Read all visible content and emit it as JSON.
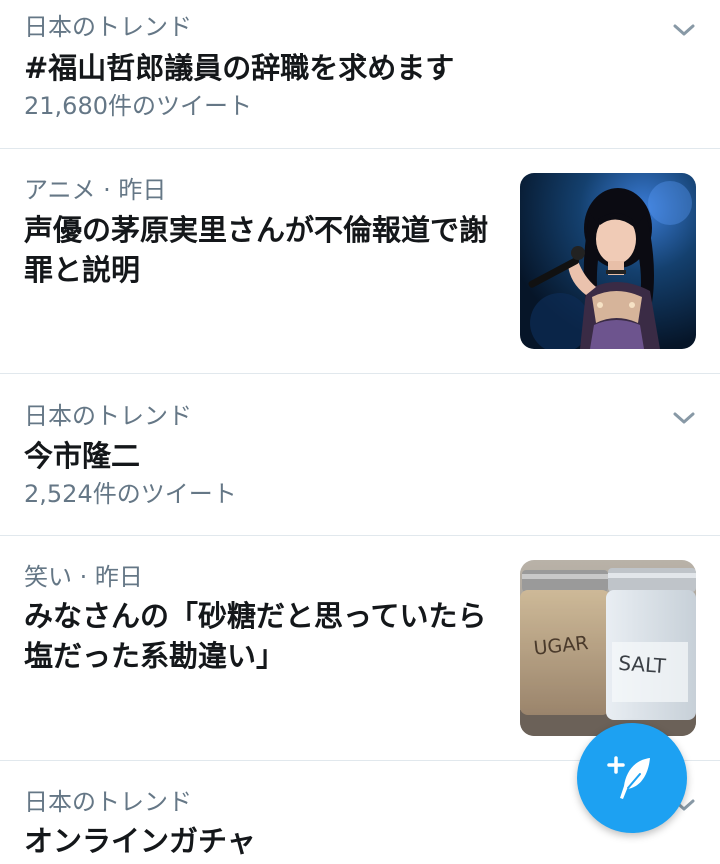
{
  "trends": [
    {
      "context": "日本のトレンド",
      "title": "#福山哲郎議員の辞職を求めます",
      "meta": "21,680件のツイート"
    },
    {
      "context": "アニメ · 昨日",
      "title": "声優の茅原実里さんが不倫報道で謝罪と説明",
      "image": "concert-singer-photo"
    },
    {
      "context": "日本のトレンド",
      "title": "今市隆二",
      "meta": "2,524件のツイート"
    },
    {
      "context": "笑い · 昨日",
      "title": "みなさんの「砂糖だと思っていたら塩だった系勘違い」",
      "image": "sugar-salt-jars-photo",
      "image_labels": {
        "left_jar": "UGAR",
        "right_jar": "SALT"
      }
    },
    {
      "context": "日本のトレンド",
      "title": "オンラインガチャ"
    }
  ],
  "icons": {
    "chevron": "chevron-down-icon",
    "fab": "compose-tweet-icon"
  },
  "colors": {
    "accent": "#1da1f2",
    "secondary_text": "#657786",
    "primary_text": "#14171a",
    "divider": "#e1e8ed"
  }
}
